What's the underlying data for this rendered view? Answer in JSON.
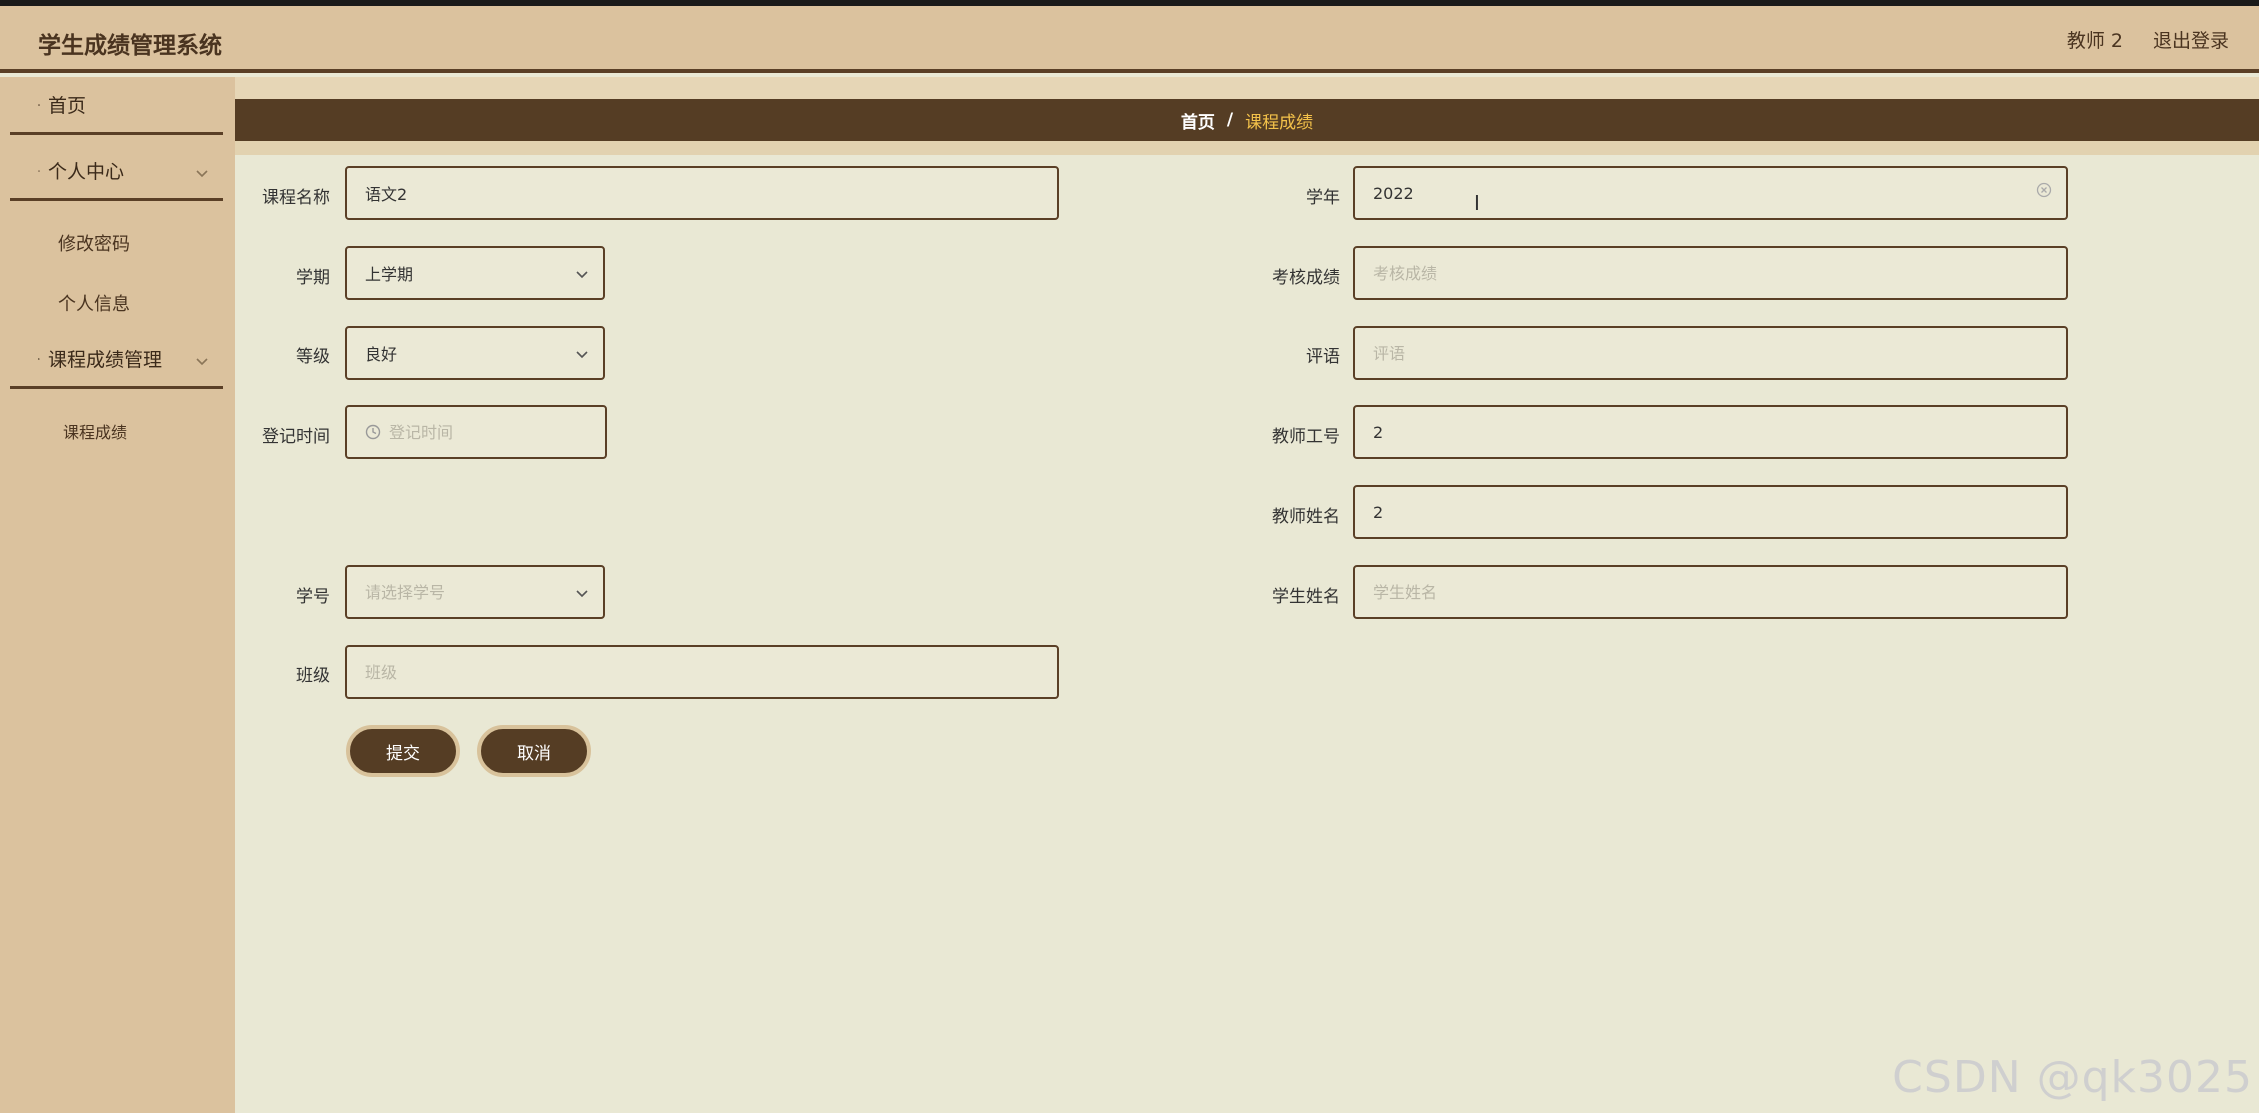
{
  "app": {
    "title": "学生成绩管理系统",
    "user_label": "教师 2",
    "logout_label": "退出登录"
  },
  "sidebar": {
    "home": "首页",
    "personal_center": "个人中心",
    "change_password": "修改密码",
    "personal_info": "个人信息",
    "course_grade_mgmt": "课程成绩管理",
    "course_grade": "课程成绩"
  },
  "breadcrumb": {
    "home": "首页",
    "separator": "/",
    "current": "课程成绩"
  },
  "form": {
    "course_name": {
      "label": "课程名称",
      "value": "语文2"
    },
    "school_year": {
      "label": "学年",
      "value": "2022"
    },
    "semester": {
      "label": "学期",
      "value": "上学期"
    },
    "assessment_score": {
      "label": "考核成绩",
      "placeholder": "考核成绩"
    },
    "grade_level": {
      "label": "等级",
      "value": "良好"
    },
    "comment": {
      "label": "评语",
      "placeholder": "评语"
    },
    "register_time": {
      "label": "登记时间",
      "placeholder": "登记时间"
    },
    "teacher_id": {
      "label": "教师工号",
      "value": "2"
    },
    "teacher_name": {
      "label": "教师姓名",
      "value": "2"
    },
    "student_id": {
      "label": "学号",
      "placeholder": "请选择学号"
    },
    "student_name": {
      "label": "学生姓名",
      "placeholder": "学生姓名"
    },
    "class": {
      "label": "班级",
      "placeholder": "班级"
    }
  },
  "buttons": {
    "submit": "提交",
    "cancel": "取消"
  },
  "watermark": "CSDN @qk3025",
  "colors": {
    "header_bg": "#dbc29e",
    "accent_dark": "#553d24",
    "content_bg": "#e9e8d4",
    "breadcrumb_current": "#f4c24a"
  }
}
